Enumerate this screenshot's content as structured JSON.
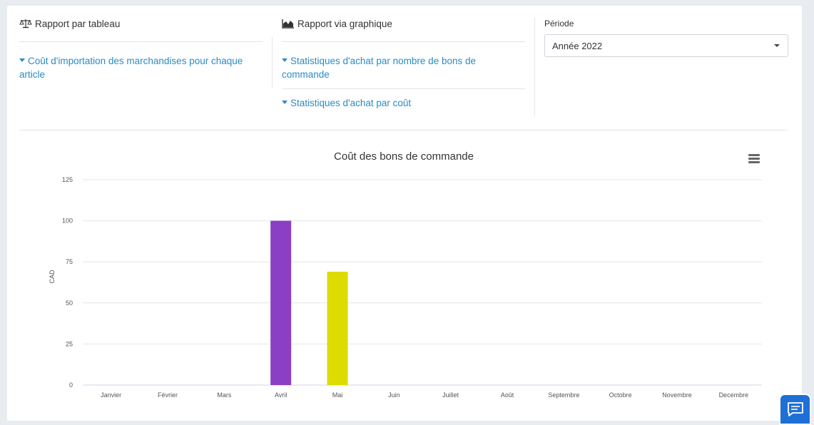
{
  "table_report": {
    "title": "Rapport par tableau",
    "icon": "scale-icon",
    "links": [
      "Coût d'importation des marchandises pour chaque article"
    ]
  },
  "graph_report": {
    "title": "Rapport via graphique",
    "icon": "area-chart-icon",
    "links": [
      "Statistiques d'achat par nombre de bons de commande",
      "Statistiques d'achat par coût"
    ]
  },
  "period": {
    "label": "Période",
    "selected": "Année 2022"
  },
  "colors": {
    "link": "#2a8bc4",
    "april_bar": "#8a3fc4",
    "may_bar": "#dcdc00",
    "chat_button": "#1f6fd6"
  },
  "chart_data": {
    "type": "bar",
    "title": "Coût des bons de commande",
    "ylabel": "CAD",
    "xlabel": "",
    "categories": [
      "Janvier",
      "Février",
      "Mars",
      "Avril",
      "Mai",
      "Juin",
      "Juillet",
      "Août",
      "Septembre",
      "Octobre",
      "Novembre",
      "Decembre"
    ],
    "values": [
      0,
      0,
      0,
      100,
      69,
      0,
      0,
      0,
      0,
      0,
      0,
      0
    ],
    "bar_colors": [
      "#8a3fc4",
      "#8a3fc4",
      "#8a3fc4",
      "#8a3fc4",
      "#dcdc00",
      "#8a3fc4",
      "#8a3fc4",
      "#8a3fc4",
      "#8a3fc4",
      "#8a3fc4",
      "#8a3fc4",
      "#8a3fc4"
    ],
    "ylim": [
      0,
      125
    ],
    "yticks": [
      0,
      25,
      50,
      75,
      100,
      125
    ],
    "grid": true,
    "legend": "none"
  }
}
